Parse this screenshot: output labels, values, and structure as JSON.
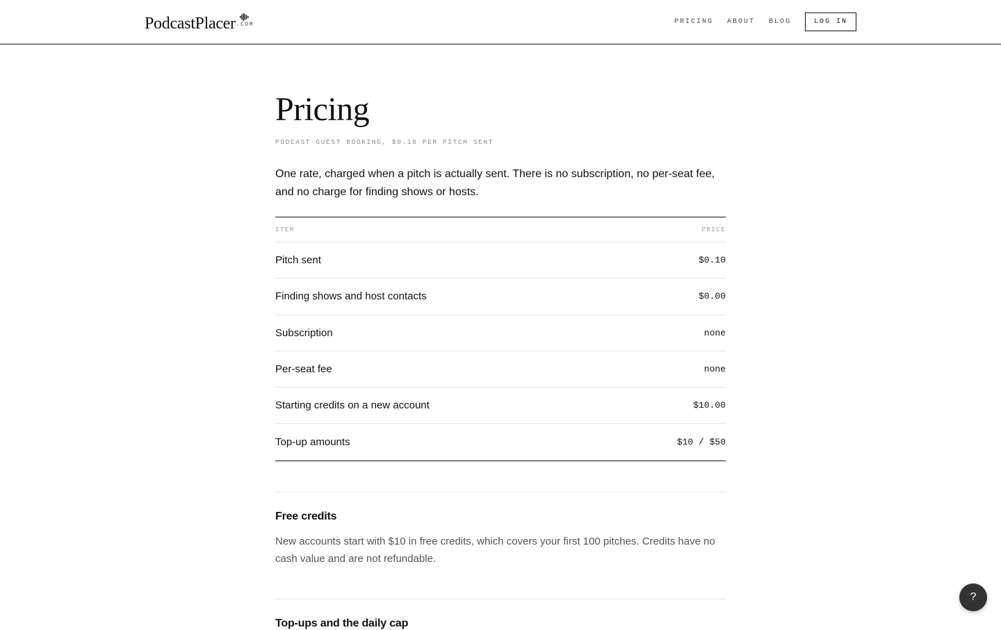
{
  "header": {
    "brand_name": "PodcastPlacer",
    "brand_suffix": ".COM",
    "nav": [
      {
        "label": "PRICING"
      },
      {
        "label": "ABOUT"
      },
      {
        "label": "BLOG"
      }
    ],
    "login_label": "LOG IN"
  },
  "page": {
    "title": "Pricing",
    "subtitle": "PODCAST GUEST BOOKING, $0.10 PER PITCH SENT",
    "intro": "One rate, charged when a pitch is actually sent. There is no subscription, no per-seat fee, and no charge for finding shows or hosts."
  },
  "table": {
    "col_item": "ITEM",
    "col_price": "PRICE",
    "rows": [
      {
        "item": "Pitch sent",
        "price": "$0.10"
      },
      {
        "item": "Finding shows and host contacts",
        "price": "$0.00"
      },
      {
        "item": "Subscription",
        "price": "none"
      },
      {
        "item": "Per-seat fee",
        "price": "none"
      },
      {
        "item": "Starting credits on a new account",
        "price": "$10.00"
      },
      {
        "item": "Top-up amounts",
        "price": "$10 / $50"
      }
    ]
  },
  "sections": [
    {
      "title": "Free credits",
      "text": "New accounts start with $10 in free credits, which covers your first 100 pitches. Credits have no cash value and are not refundable."
    },
    {
      "title": "Top-ups and the daily cap",
      "text": ""
    }
  ],
  "help_label": "?",
  "icons": {
    "brand_mark": "sound-wave-icon"
  }
}
